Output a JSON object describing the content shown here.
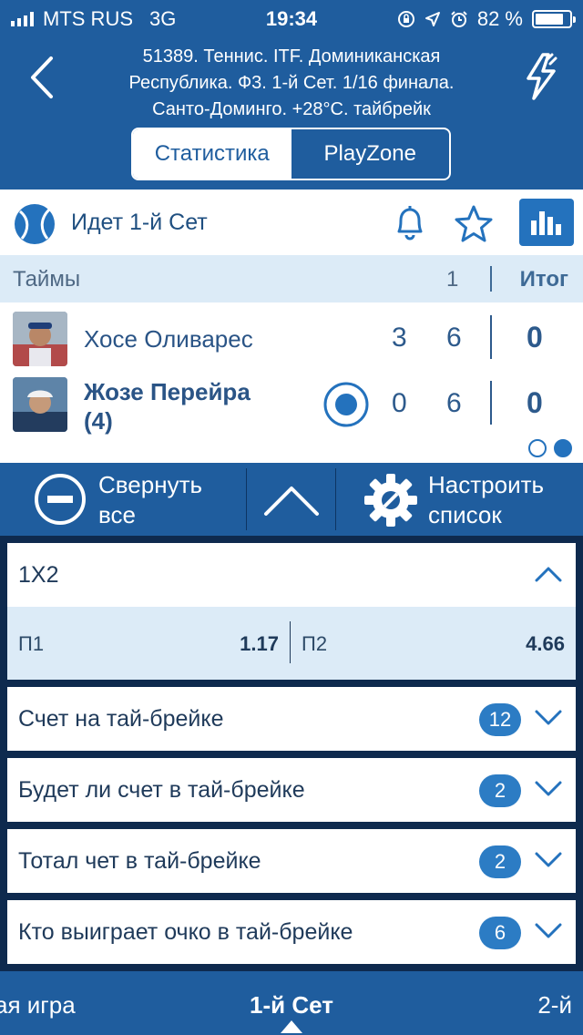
{
  "status": {
    "carrier": "MTS RUS",
    "network": "3G",
    "time": "19:34",
    "battery": "82 %",
    "battery_level": 0.82
  },
  "header": {
    "title_lines": [
      "51389. Теннис. ITF. Доминиканская",
      "Республика. Ф3. 1-й  Сет. 1/16 финала.",
      "Санто-Доминго. +28°C. тайбрейк"
    ],
    "tabs": [
      {
        "label": "Статистика"
      },
      {
        "label": "PlayZone"
      }
    ]
  },
  "live": {
    "status_text": "Идет 1-й  Сет"
  },
  "score_table": {
    "header_label": "Таймы",
    "set_number": "1",
    "total_label": "Итог",
    "players": [
      {
        "name": "Хосе Оливарес",
        "name2": "",
        "games": "3",
        "set": "6",
        "total": "0",
        "serving": false
      },
      {
        "name": "Жозе Перейра",
        "name2": "(4)",
        "games": "0",
        "set": "6",
        "total": "0",
        "serving": true
      }
    ]
  },
  "toolbar": {
    "collapse_label": [
      "Свернуть",
      "все"
    ],
    "settings_label": [
      "Настроить",
      "список"
    ]
  },
  "markets": [
    {
      "title": "1X2",
      "expanded": true,
      "odds": [
        {
          "label": "П1",
          "value": "1.17"
        },
        {
          "label": "П2",
          "value": "4.66"
        }
      ]
    },
    {
      "title": "Счет на тай-брейке",
      "count": "12"
    },
    {
      "title": "Будет ли счет в тай-брейке",
      "count": "2"
    },
    {
      "title": "Тотал чет в тай-брейке",
      "count": "2"
    },
    {
      "title": "Кто выиграет очко в тай-брейке",
      "count": "6"
    }
  ],
  "bottom_nav": {
    "prev": "ая игра",
    "current": "1-й  Сет",
    "next": "2-й"
  },
  "colors": {
    "primary": "#1f5d9e",
    "accent": "#2472bd",
    "dark_bg": "#0e2a4e",
    "light_row": "#dcebf7"
  },
  "icons": [
    "back-icon",
    "lightning-icon",
    "tennis-ball-icon",
    "bell-icon",
    "star-icon",
    "stats-icon",
    "serve-icon",
    "collapse-icon",
    "chevron-up-icon",
    "gear-icon",
    "chevron-down-icon"
  ]
}
